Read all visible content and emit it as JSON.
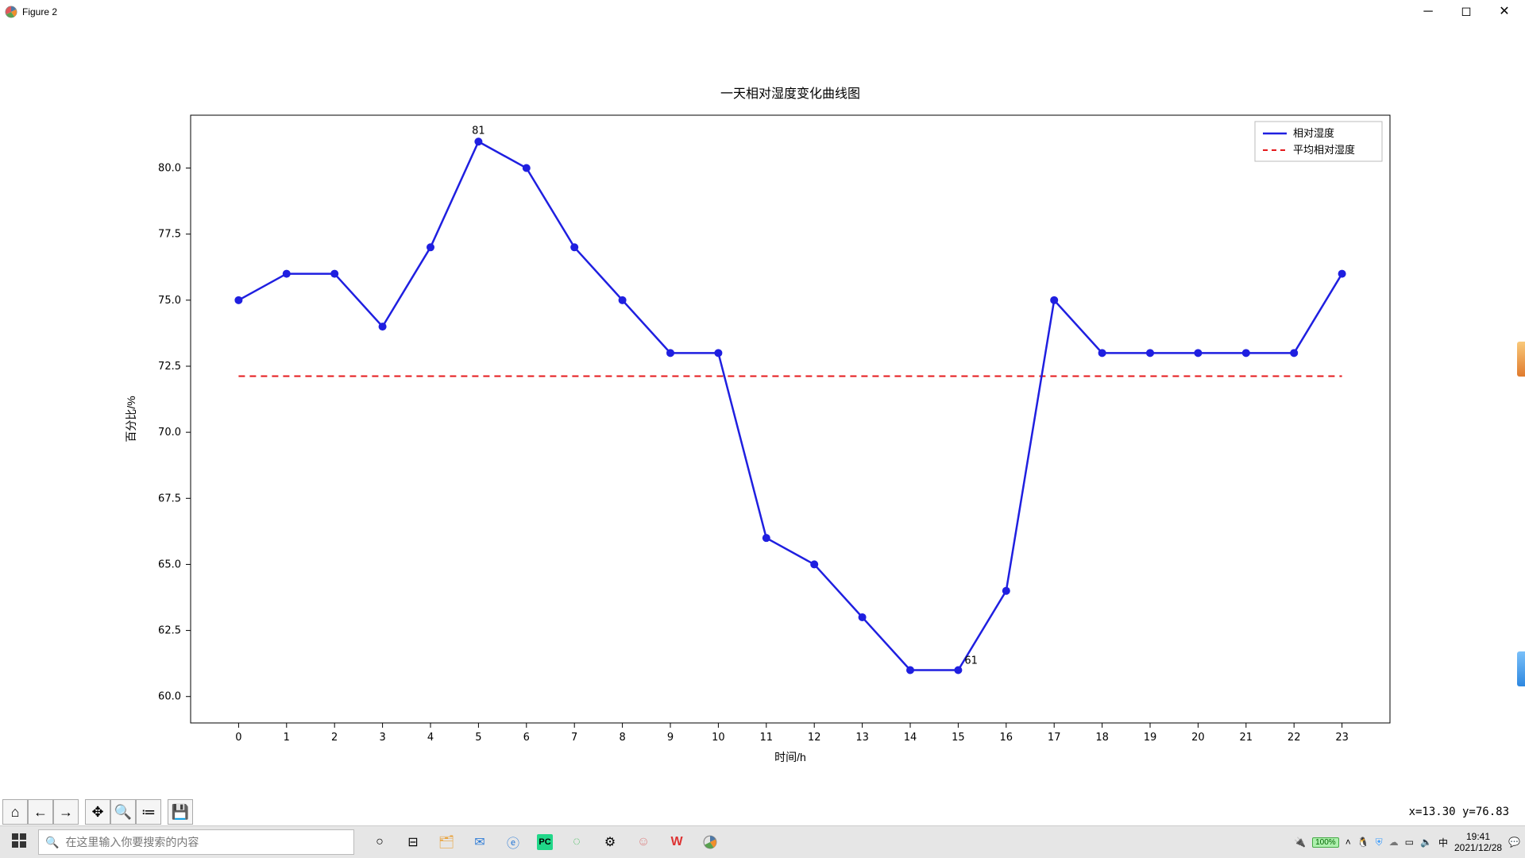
{
  "window": {
    "title": "Figure 2"
  },
  "chart_data": {
    "type": "line",
    "title": "一天相对湿度变化曲线图",
    "xlabel": "时间/h",
    "ylabel": "百分比/%",
    "x": [
      0,
      1,
      2,
      3,
      4,
      5,
      6,
      7,
      8,
      9,
      10,
      11,
      12,
      13,
      14,
      15,
      16,
      17,
      18,
      19,
      20,
      21,
      22,
      23
    ],
    "y": [
      75,
      76,
      76,
      74,
      77,
      81,
      80,
      77,
      75,
      73,
      73,
      66,
      65,
      63,
      61,
      61,
      64,
      75,
      73,
      73,
      73,
      73,
      73,
      76
    ],
    "yticks": [
      60.0,
      62.5,
      65.0,
      67.5,
      70.0,
      72.5,
      75.0,
      77.5,
      80.0
    ],
    "ytick_labels": [
      "60.0",
      "62.5",
      "65.0",
      "67.5",
      "70.0",
      "72.5",
      "75.0",
      "77.5",
      "80.0"
    ],
    "series": [
      {
        "name": "相对湿度",
        "style": "solid",
        "color": "#1f1fe0"
      }
    ],
    "reference_lines": [
      {
        "name": "平均相对湿度",
        "y": 72.125,
        "style": "dashed",
        "color": "#e41a1c"
      }
    ],
    "annotations": [
      {
        "text": "81",
        "x": 5,
        "y": 81,
        "pos": "above"
      },
      {
        "text": "61",
        "x": 15,
        "y": 61,
        "pos": "above-right"
      }
    ],
    "legend": [
      "相对湿度",
      "平均相对湿度"
    ],
    "xlim": [
      -1,
      24
    ],
    "ylim": [
      59,
      82
    ]
  },
  "toolbar": {
    "home": "⌂",
    "back": "←",
    "forward": "→",
    "pan": "✥",
    "zoom": "🔍",
    "configure": "≔",
    "save": "💾"
  },
  "status": {
    "coord": "x=13.30 y=76.83"
  },
  "taskbar": {
    "search_placeholder": "在这里输入你要搜索的内容",
    "time": "19:41",
    "date": "2021/12/28",
    "ime": "中",
    "battery": "100%"
  }
}
